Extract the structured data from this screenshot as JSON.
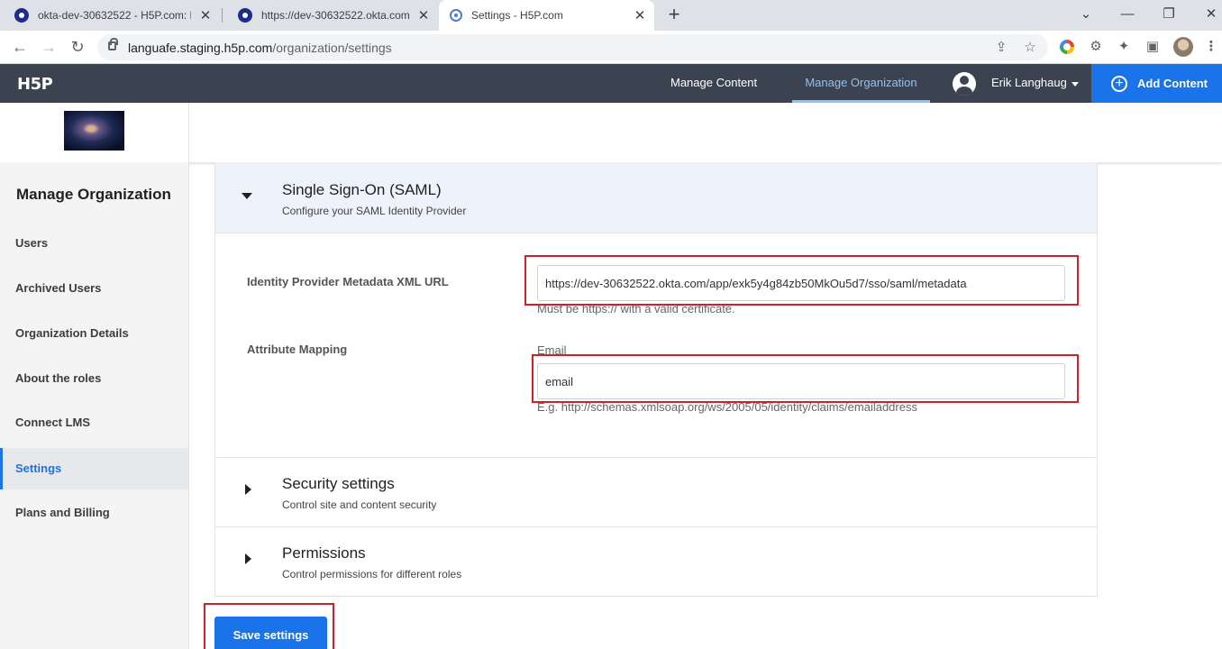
{
  "browser": {
    "tabs": [
      {
        "title": "okta-dev-30632522 - H5P.com: H"
      },
      {
        "title": "https://dev-30632522.okta.com/a"
      },
      {
        "title": "Settings - H5P.com"
      }
    ],
    "new_tab": "+",
    "close_glyph": "✕",
    "window_controls": {
      "tab_search": "⌄",
      "minimize": "—",
      "restore": "❐",
      "close": "✕"
    },
    "url_host": "languafe.staging.h5p.com",
    "url_path": "/organization/settings",
    "nav_icons": {
      "back": "←",
      "forward": "→",
      "reload": "↻"
    }
  },
  "app": {
    "logo": "H5P",
    "nav": {
      "manage_content": "Manage Content",
      "manage_organization": "Manage Organization"
    },
    "user_name": "Erik Langhaug",
    "add_content": "Add Content",
    "accent": "#1a73e8",
    "header_bg": "#3b4350"
  },
  "sidebar": {
    "title": "Manage Organization",
    "items": [
      {
        "label": "Users"
      },
      {
        "label": "Archived Users"
      },
      {
        "label": "Organization Details"
      },
      {
        "label": "About the roles"
      },
      {
        "label": "Connect LMS"
      },
      {
        "label": "Settings"
      },
      {
        "label": "Plans and Billing"
      }
    ],
    "active_item": "Settings"
  },
  "sso": {
    "title": "Single Sign-On (SAML)",
    "subtitle": "Configure your SAML Identity Provider",
    "metadata_label": "Identity Provider Metadata XML URL",
    "metadata_value": "https://dev-30632522.okta.com/app/exk5y4g84zb50MkOu5d7/sso/saml/metadata",
    "metadata_hint": "Must be https:// with a valid certificate.",
    "mapping_label": "Attribute Mapping",
    "email_label": "Email",
    "email_value": "email",
    "email_hint": "E.g. http://schemas.xmlsoap.org/ws/2005/05/identity/claims/emailaddress"
  },
  "security": {
    "title": "Security settings",
    "subtitle": "Control site and content security"
  },
  "permissions": {
    "title": "Permissions",
    "subtitle": "Control permissions for different roles"
  },
  "save_label": "Save settings",
  "highlight_color": "#d0202a"
}
